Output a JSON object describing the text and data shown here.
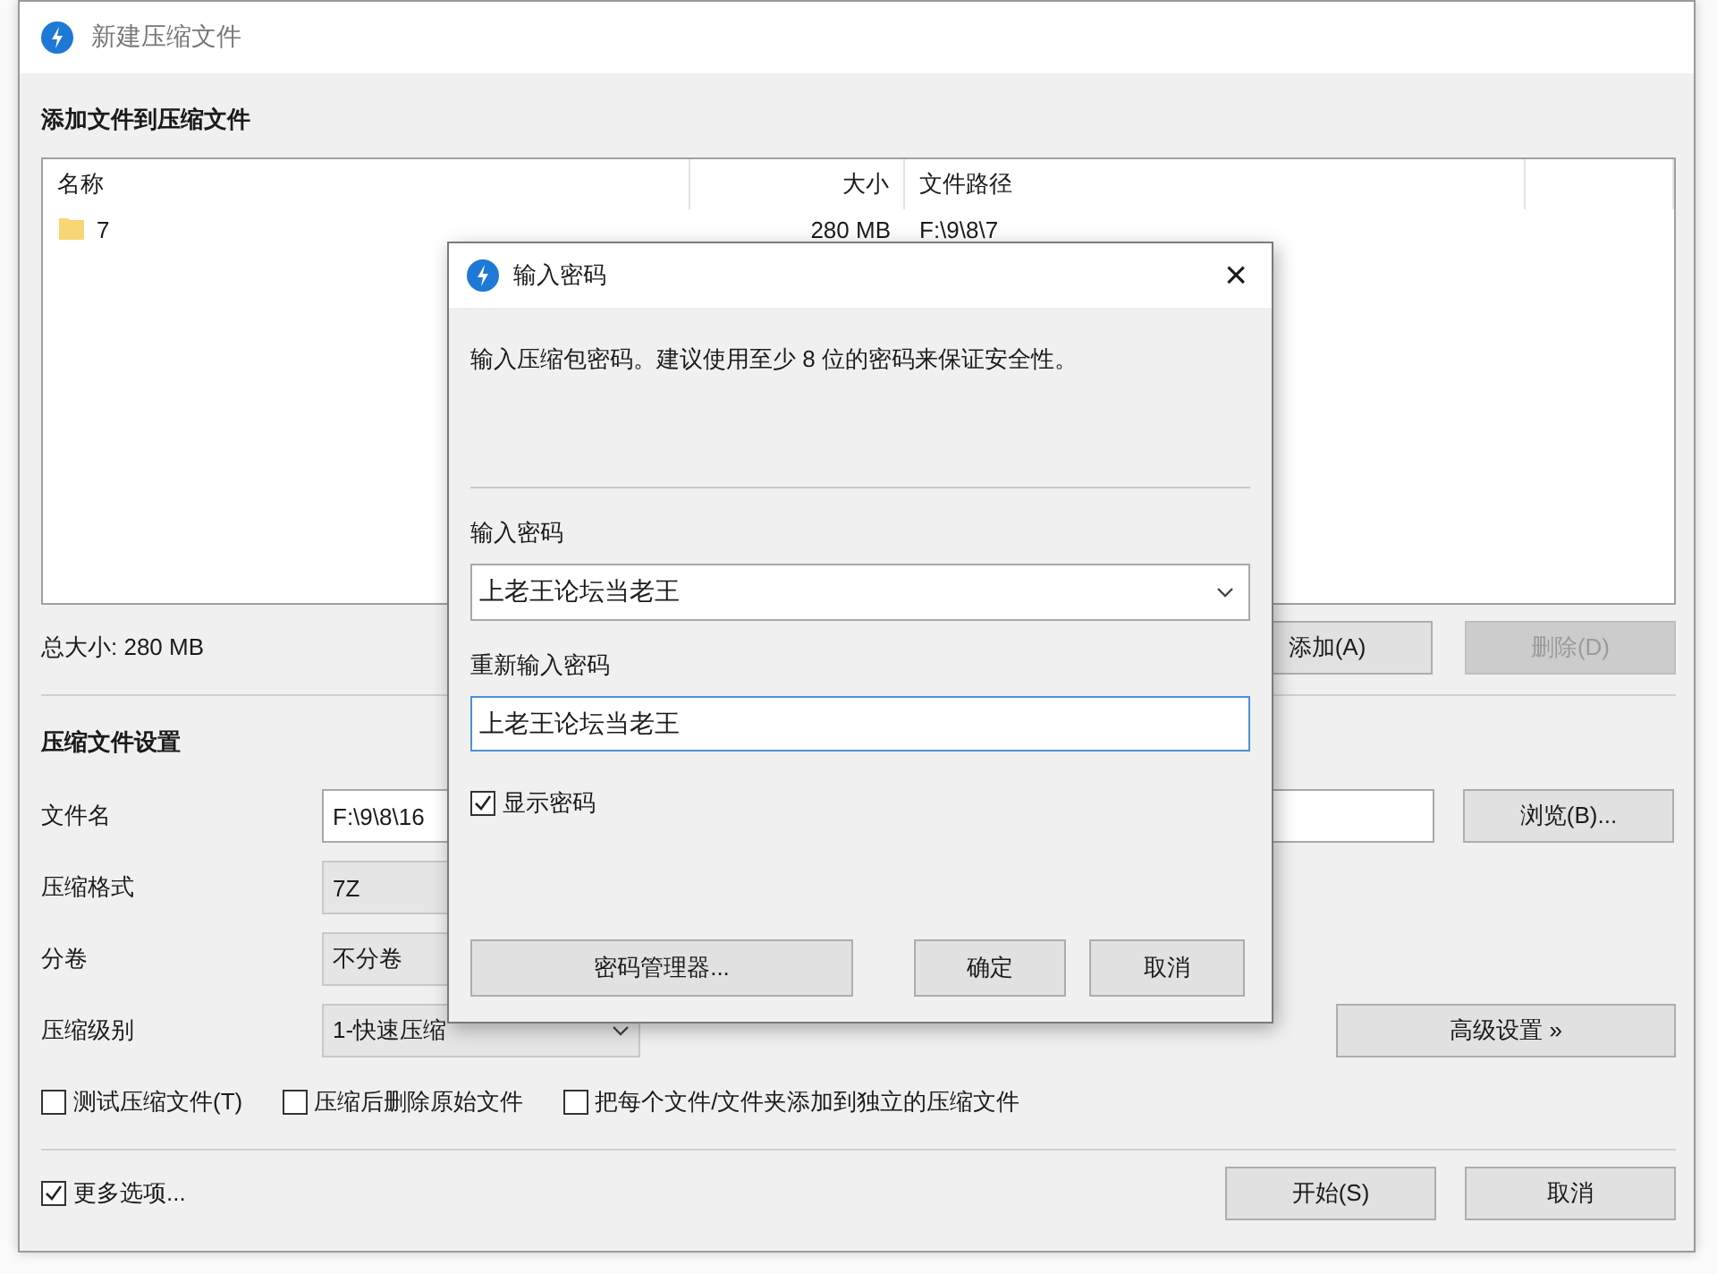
{
  "window": {
    "title": "新建压缩文件"
  },
  "files_section": {
    "heading": "添加文件到压缩文件",
    "columns": [
      "名称",
      "大小",
      "文件路径"
    ],
    "rows": [
      {
        "name": "7",
        "size": "280 MB",
        "path": "F:\\9\\8\\7"
      }
    ],
    "total": "总大小: 280 MB",
    "buttons": [
      {
        "label": "添加(A)",
        "disabled": false
      },
      {
        "label": "删除(D)",
        "disabled": true
      }
    ]
  },
  "settings": {
    "heading": "压缩文件设置",
    "fields": [
      {
        "label": "文件名",
        "kind": "text",
        "value": "F:\\9\\8\\16"
      },
      {
        "label": "压缩格式",
        "kind": "box",
        "value": "7Z"
      },
      {
        "label": "分卷",
        "kind": "box",
        "value": "不分卷"
      },
      {
        "label": "压缩级别",
        "kind": "select",
        "value": "1-快速压缩"
      }
    ],
    "browse_button": "浏览(B)...",
    "advanced_button": "高级设置 »",
    "options": [
      {
        "label": "测试压缩文件(T)",
        "checked": false
      },
      {
        "label": "压缩后删除原始文件",
        "checked": false
      },
      {
        "label": "把每个文件/文件夹添加到独立的压缩文件",
        "checked": false
      }
    ]
  },
  "footer": {
    "more_options": {
      "label": "更多选项...",
      "checked": true
    },
    "buttons": [
      "开始(S)",
      "取消"
    ]
  },
  "password_dialog": {
    "title": "输入密码",
    "close": "×",
    "description": "输入压缩包密码。建议使用至少 8 位的密码来保证安全性。",
    "password_label": "输入密码",
    "password_value": "上老王论坛当老王",
    "confirm_label": "重新输入密码",
    "confirm_value": "上老王论坛当老王",
    "show_password": {
      "label": "显示密码",
      "checked": true
    },
    "buttons": [
      "密码管理器...",
      "确定",
      "取消"
    ]
  }
}
